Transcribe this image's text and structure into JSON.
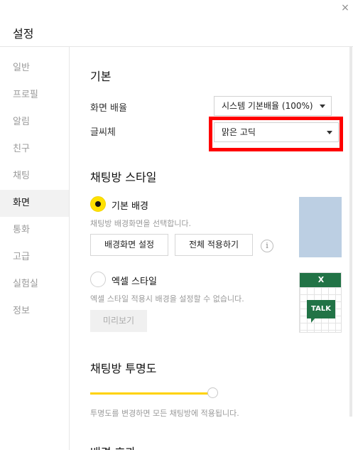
{
  "window": {
    "title": "설정",
    "close_label": "×"
  },
  "sidebar": {
    "items": [
      {
        "label": "일반"
      },
      {
        "label": "프로필"
      },
      {
        "label": "알림"
      },
      {
        "label": "친구"
      },
      {
        "label": "채팅"
      },
      {
        "label": "화면"
      },
      {
        "label": "통화"
      },
      {
        "label": "고급"
      },
      {
        "label": "실험실"
      },
      {
        "label": "정보"
      }
    ],
    "active_index": 5
  },
  "basic": {
    "heading": "기본",
    "zoom": {
      "label": "화면 배율",
      "value": "시스템 기본배율 (100%)"
    },
    "font": {
      "label": "글씨체",
      "value": "맑은 고딕"
    }
  },
  "chatroom_style": {
    "heading": "채팅방 스타일",
    "default_bg": {
      "label": "기본 배경",
      "selected": true,
      "desc": "채팅방 배경화면을 선택합니다."
    },
    "buttons": {
      "set_wallpaper": "배경화면 설정",
      "apply_all": "전체 적용하기"
    },
    "info_icon": "i",
    "excel_style": {
      "label": "엑셀 스타일",
      "selected": false,
      "desc": "엑셀 스타일 적용시 배경을 설정할 수 없습니다."
    },
    "preview_button": "미리보기",
    "excel_preview": {
      "header": "X",
      "badge": "TALK"
    }
  },
  "transparency": {
    "heading": "채팅방 투명도",
    "value_fraction": 1.0,
    "desc": "투명도를 변경하면 모든 채팅방에 적용됩니다."
  },
  "next_section": {
    "heading": "배경 효과"
  },
  "colors": {
    "accent": "#ffe100",
    "highlight": "#ff0000",
    "excel_green": "#217346",
    "preview_blue": "#bccfe3"
  }
}
